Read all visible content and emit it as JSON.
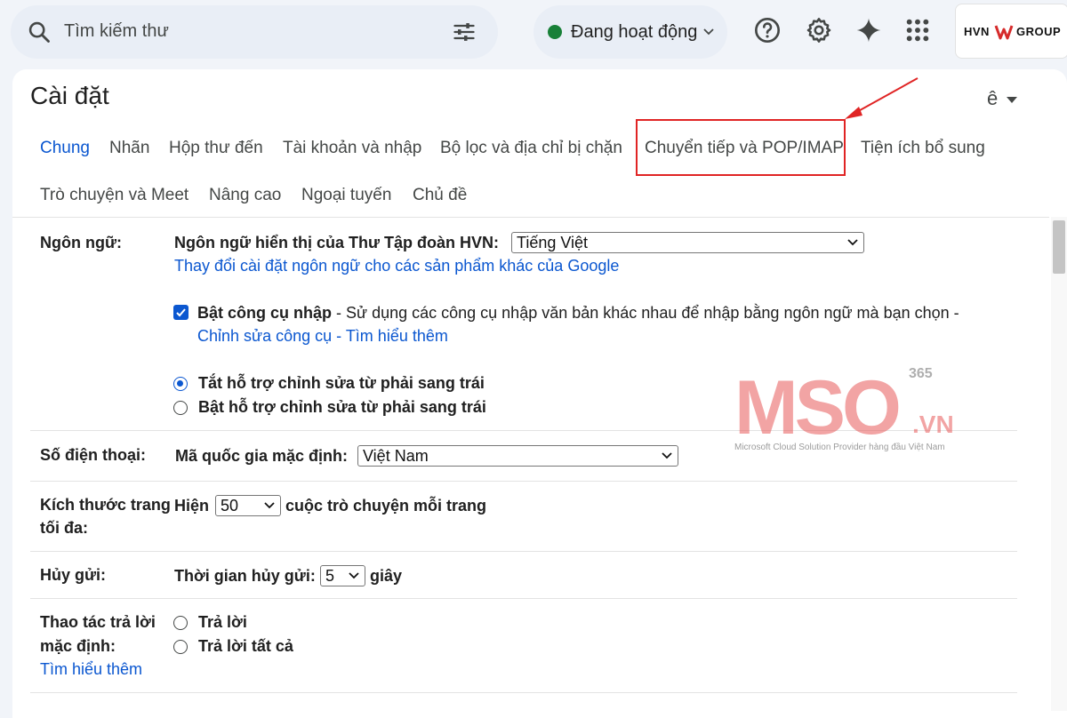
{
  "search": {
    "placeholder": "Tìm kiếm thư"
  },
  "status": {
    "label": "Đang hoạt động",
    "color": "#188038"
  },
  "org_logo": {
    "left": "HVN",
    "right": "GROUP"
  },
  "settings": {
    "title": "Cài đặt",
    "input_tools_label": "ê",
    "tabs": [
      {
        "label": "Chung",
        "active": true
      },
      {
        "label": "Nhãn"
      },
      {
        "label": "Hộp thư đến"
      },
      {
        "label": "Tài khoản và nhập"
      },
      {
        "label": "Bộ lọc và địa chỉ bị chặn"
      },
      {
        "label": "Chuyển tiếp và POP/IMAP"
      },
      {
        "label": "Tiện ích bổ sung"
      },
      {
        "label": "Trò chuyện và Meet"
      },
      {
        "label": "Nâng cao"
      },
      {
        "label": "Ngoại tuyến"
      },
      {
        "label": "Chủ đề"
      }
    ]
  },
  "language": {
    "label": "Ngôn ngữ:",
    "display_label": "Ngôn ngữ hiển thị của Thư Tập đoàn HVN:",
    "display_value": "Tiếng Việt",
    "change_link": "Thay đổi cài đặt ngôn ngữ cho các sản phẩm khác của Google",
    "input_tools_title": "Bật công cụ nhập",
    "input_tools_desc": " - Sử dụng các công cụ nhập văn bản khác nhau để nhập bằng ngôn ngữ mà bạn chọn -",
    "edit_tools_link": "Chỉnh sửa công cụ",
    "dash": " - ",
    "learn_more": "Tìm hiểu thêm",
    "rtl_off": "Tắt hỗ trợ chỉnh sửa từ phải sang trái",
    "rtl_on": "Bật hỗ trợ chỉnh sửa từ phải sang trái"
  },
  "phone": {
    "label": "Số điện thoại:",
    "country_label": "Mã quốc gia mặc định:",
    "country_value": "Việt Nam"
  },
  "page_size": {
    "label_line1": "Kích thước trang",
    "label_line2": "tối đa:",
    "show": "Hiện",
    "value": "50",
    "suffix": "cuộc trò chuyện mỗi trang"
  },
  "undo_send": {
    "label": "Hủy gửi:",
    "period_label": "Thời gian hủy gửi:",
    "value": "5",
    "unit": "giây"
  },
  "reply": {
    "label_line1": "Thao tác trả lời",
    "label_line2": "mặc định:",
    "learn_more": "Tìm hiểu thêm",
    "opt_reply": "Trả lời",
    "opt_reply_all": "Trả lời tất cả"
  },
  "watermark": {
    "brand": "MSO",
    "sup": "365",
    "tld": ".VN",
    "tagline": "Microsoft Cloud Solution Provider hàng đầu Việt Nam"
  }
}
